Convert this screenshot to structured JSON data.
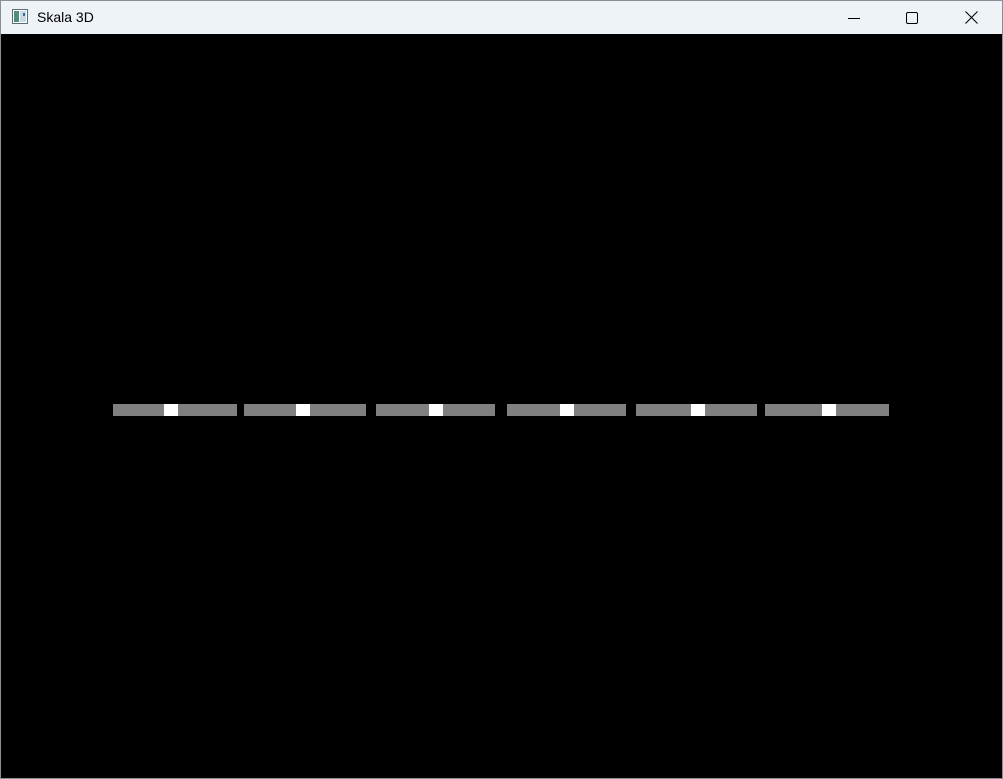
{
  "window": {
    "title": "Skala 3D",
    "icon": "app-window-icon",
    "controls": [
      "minimize-icon",
      "maximize-icon",
      "close-icon"
    ]
  },
  "canvas": {
    "background": "#000000"
  },
  "sliders": [
    {
      "name": "slider-1",
      "value": 0.47,
      "track_color": "#808080",
      "thumb_color": "#ffffff"
    },
    {
      "name": "slider-2",
      "value": 0.48,
      "track_color": "#808080",
      "thumb_color": "#ffffff"
    },
    {
      "name": "slider-3",
      "value": 0.5,
      "track_color": "#808080",
      "thumb_color": "#ffffff"
    },
    {
      "name": "slider-4",
      "value": 0.5,
      "track_color": "#808080",
      "thumb_color": "#ffffff"
    },
    {
      "name": "slider-5",
      "value": 0.51,
      "track_color": "#808080",
      "thumb_color": "#ffffff"
    },
    {
      "name": "slider-6",
      "value": 0.52,
      "track_color": "#808080",
      "thumb_color": "#ffffff"
    }
  ]
}
